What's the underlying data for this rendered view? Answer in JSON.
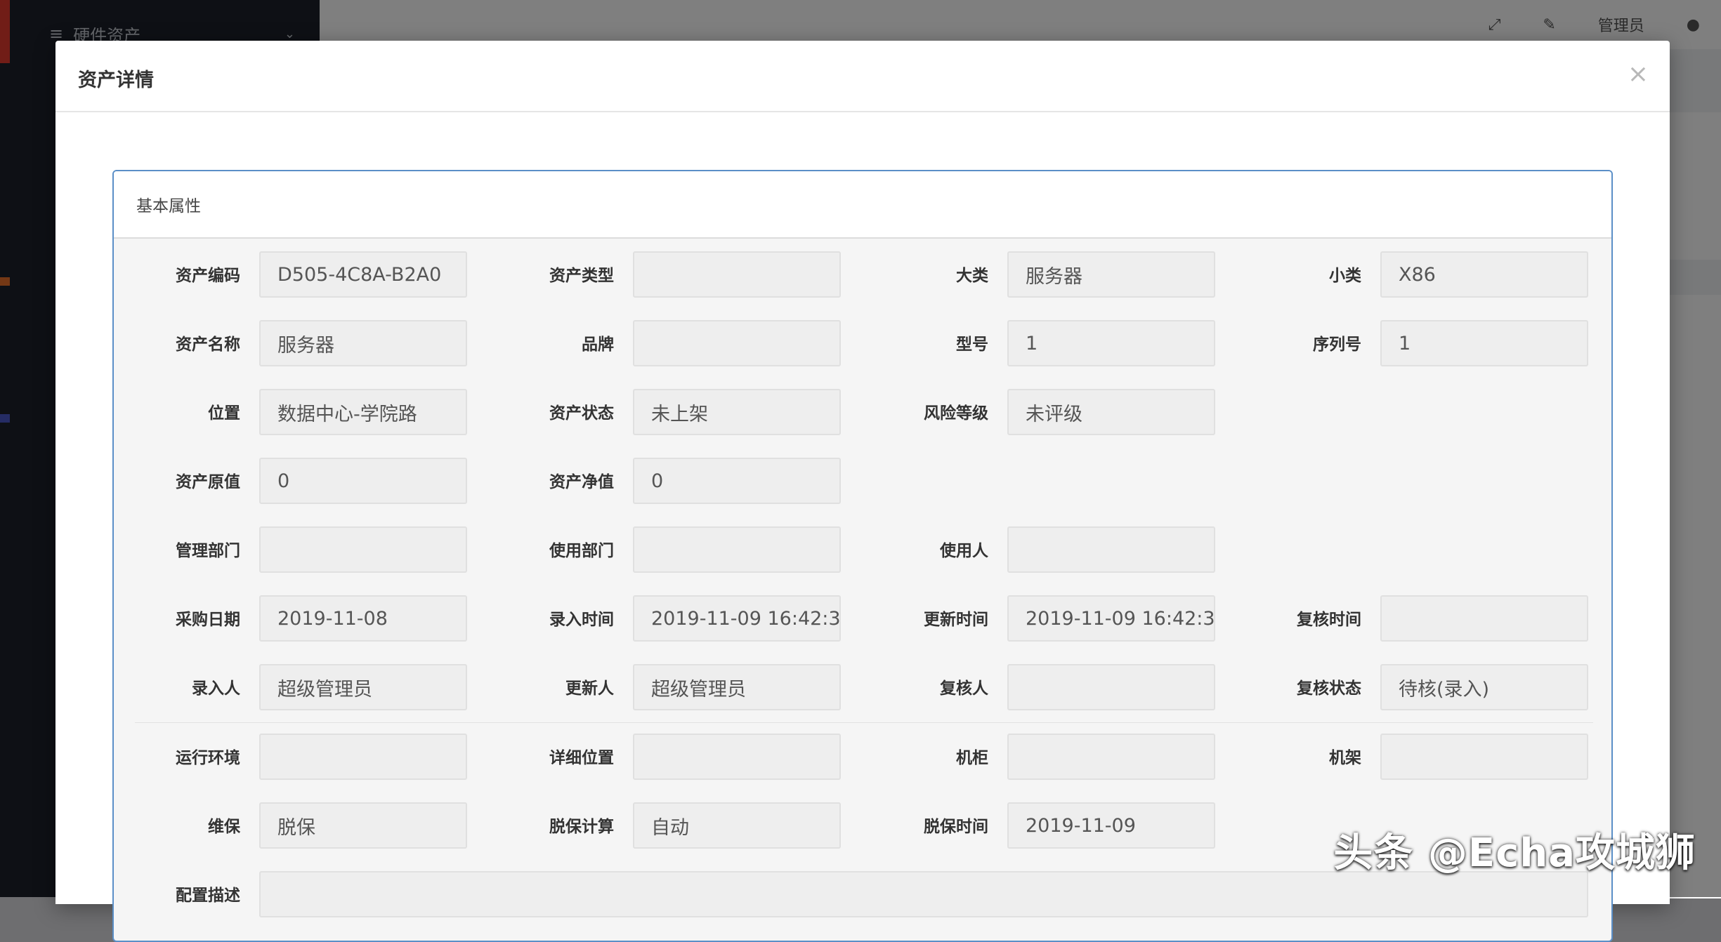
{
  "background": {
    "sidebar_item": "硬件资产",
    "topbar_user": "管理员"
  },
  "modal": {
    "title": "资产详情",
    "close_symbol": "×"
  },
  "panel": {
    "heading": "基本属性"
  },
  "fields": {
    "asset_code": {
      "label": "资产编码",
      "value": "D505-4C8A-B2A0"
    },
    "asset_type": {
      "label": "资产类型",
      "value": ""
    },
    "category": {
      "label": "大类",
      "value": "服务器"
    },
    "subcategory": {
      "label": "小类",
      "value": "X86"
    },
    "asset_name": {
      "label": "资产名称",
      "value": "服务器"
    },
    "brand": {
      "label": "品牌",
      "value": ""
    },
    "model": {
      "label": "型号",
      "value": "1"
    },
    "serial": {
      "label": "序列号",
      "value": "1"
    },
    "location": {
      "label": "位置",
      "value": "数据中心-学院路"
    },
    "status": {
      "label": "资产状态",
      "value": "未上架"
    },
    "risk": {
      "label": "风险等级",
      "value": "未评级"
    },
    "orig_value": {
      "label": "资产原值",
      "value": "0"
    },
    "net_value": {
      "label": "资产净值",
      "value": "0"
    },
    "mgmt_dept": {
      "label": "管理部门",
      "value": ""
    },
    "use_dept": {
      "label": "使用部门",
      "value": ""
    },
    "user": {
      "label": "使用人",
      "value": ""
    },
    "purchase_date": {
      "label": "采购日期",
      "value": "2019-11-08"
    },
    "entry_time": {
      "label": "录入时间",
      "value": "2019-11-09 16:42:3"
    },
    "update_time": {
      "label": "更新时间",
      "value": "2019-11-09 16:42:3"
    },
    "review_time": {
      "label": "复核时间",
      "value": ""
    },
    "entered_by": {
      "label": "录入人",
      "value": "超级管理员"
    },
    "updated_by": {
      "label": "更新人",
      "value": "超级管理员"
    },
    "reviewer": {
      "label": "复核人",
      "value": ""
    },
    "review_status": {
      "label": "复核状态",
      "value": "待核(录入)"
    },
    "environment": {
      "label": "运行环境",
      "value": ""
    },
    "detail_loc": {
      "label": "详细位置",
      "value": ""
    },
    "cabinet": {
      "label": "机柜",
      "value": ""
    },
    "rack": {
      "label": "机架",
      "value": ""
    },
    "warranty": {
      "label": "维保",
      "value": "脱保"
    },
    "warranty_calc": {
      "label": "脱保计算",
      "value": "自动"
    },
    "warranty_end": {
      "label": "脱保时间",
      "value": "2019-11-09"
    },
    "config_desc": {
      "label": "配置描述",
      "value": ""
    }
  },
  "watermark": "头条 @Echa攻城狮"
}
